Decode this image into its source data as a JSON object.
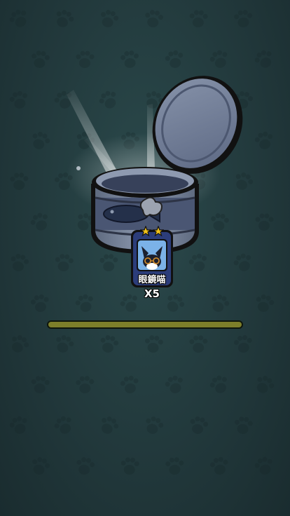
{
  "reward": {
    "card_name": "眼鏡喵",
    "quantity_text": "X5",
    "stars": 2
  },
  "progress": {
    "value": 1.0
  },
  "icons": {
    "can": "open-fish-can-icon",
    "lid": "can-lid-icon",
    "cat": "glasses-cat-avatar-icon",
    "star": "star-icon",
    "paw": "paw-print-icon"
  },
  "colors": {
    "background": "#223a3d",
    "progress_fill": "#7d7f2a",
    "card_frame": "#2c3d7a",
    "star": "#f2c21a"
  }
}
